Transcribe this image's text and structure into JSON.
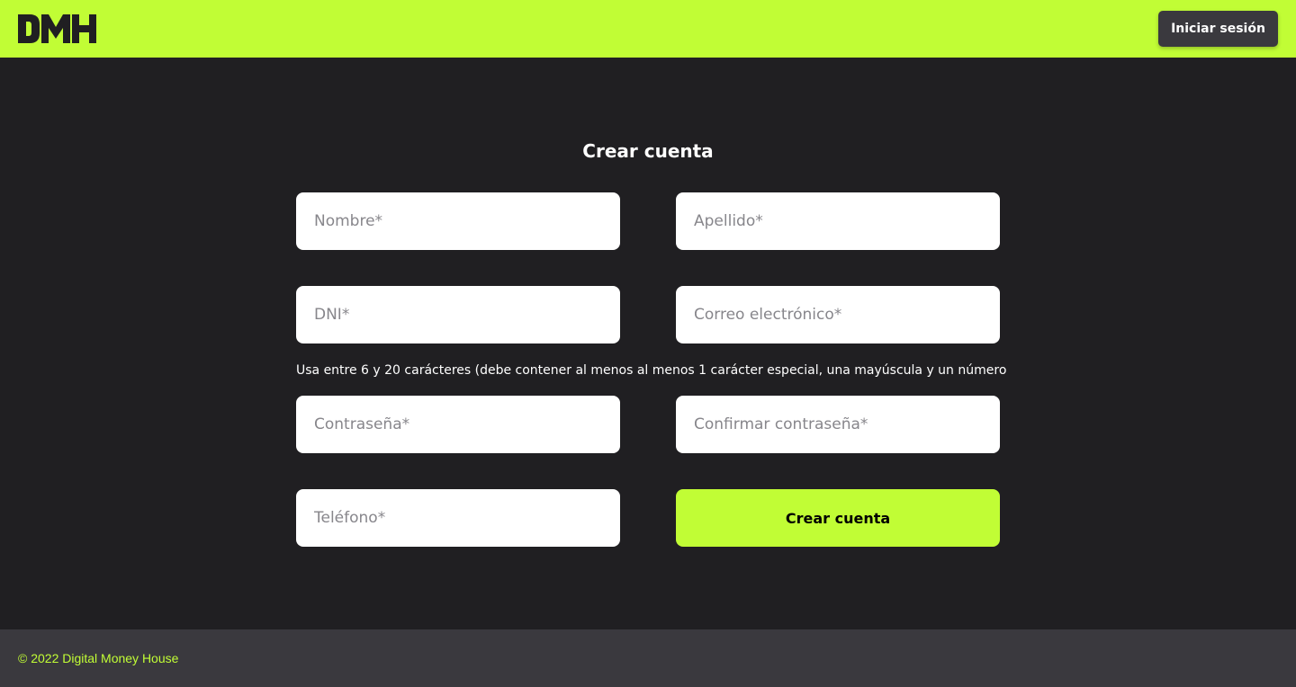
{
  "brand": {
    "name": "DMH",
    "accent_color": "#c1fd35",
    "dark_color": "#201f22"
  },
  "header": {
    "login_label": "Iniciar sesión"
  },
  "form": {
    "title": "Crear cuenta",
    "first_name_placeholder": "Nombre*",
    "last_name_placeholder": "Apellido*",
    "dni_placeholder": "DNI*",
    "email_placeholder": "Correo electrónico*",
    "password_hint": "Usa entre 6 y 20 carácteres (debe contener al menos al menos 1 carácter especial, una mayúscula y un número",
    "password_placeholder": "Contraseña*",
    "confirm_password_placeholder": "Confirmar contraseña*",
    "phone_placeholder": "Teléfono*",
    "submit_label": "Crear cuenta"
  },
  "footer": {
    "copyright": "© 2022 Digital Money House"
  }
}
